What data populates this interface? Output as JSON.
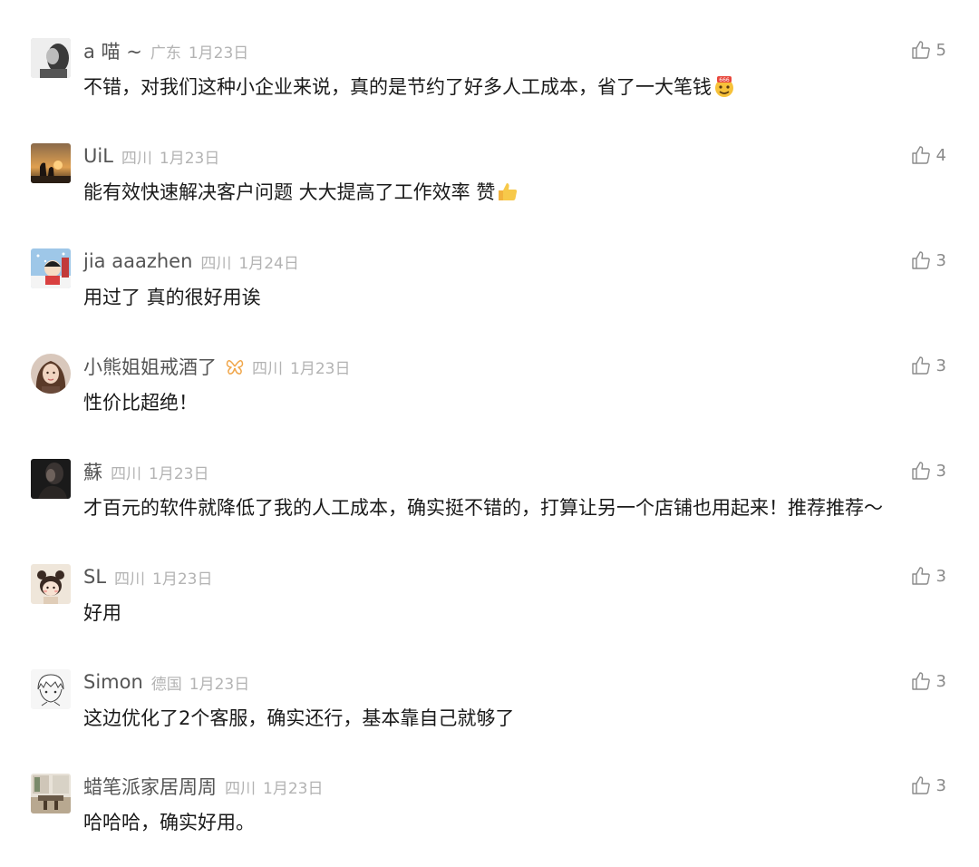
{
  "comments": [
    {
      "username": "a  喵 ~",
      "location": "广东",
      "date": "1月23日",
      "text": "不错，对我们这种小企业来说，真的是节约了好多人工成本，省了一大笔钱",
      "text_emoji": "666-face-emoji",
      "likes": "5",
      "avatar": "avatar-grayscale-portrait"
    },
    {
      "username": "UiL",
      "location": "四川",
      "date": "1月23日",
      "text": "能有效快速解决客户问题  大大提高了工作效率 赞",
      "text_emoji": "thumbs-up-emoji",
      "likes": "4",
      "avatar": "avatar-sunset-silhouette"
    },
    {
      "username": "jia aaazhen",
      "location": "四川",
      "date": "1月24日",
      "text": "用过了 真的很好用诶",
      "likes": "3",
      "avatar": "avatar-cartoon-snow"
    },
    {
      "username": "小熊姐姐戒酒了",
      "user_badge": "butterfly-badge-icon",
      "location": "四川",
      "date": "1月23日",
      "text": "性价比超绝！",
      "likes": "3",
      "avatar": "avatar-girl-portrait"
    },
    {
      "username": "蘇",
      "location": "四川",
      "date": "1月23日",
      "text": "才百元的软件就降低了我的人工成本，确实挺不错的，打算让另一个店铺也用起来！推荐推荐～",
      "likes": "3",
      "avatar": "avatar-dark-portrait"
    },
    {
      "username": "SL",
      "location": "四川",
      "date": "1月23日",
      "text": "好用",
      "likes": "3",
      "avatar": "avatar-cartoon-bear"
    },
    {
      "username": "Simon",
      "location": "德国",
      "date": "1月23日",
      "text": "这边优化了2个客服，确实还行，基本靠自己就够了",
      "likes": "3",
      "avatar": "avatar-sketch-boy"
    },
    {
      "username": "蜡笔派家居周周",
      "location": "四川",
      "date": "1月23日",
      "text": "哈哈哈，确实好用。",
      "likes": "3",
      "avatar": "avatar-interior-room"
    }
  ],
  "colors": {
    "username": "#555555",
    "meta": "#b3b3b3",
    "text": "#1a1a1a",
    "like": "#8a8a8a"
  },
  "icons": {
    "like": "thumbs-up-outline-icon"
  }
}
